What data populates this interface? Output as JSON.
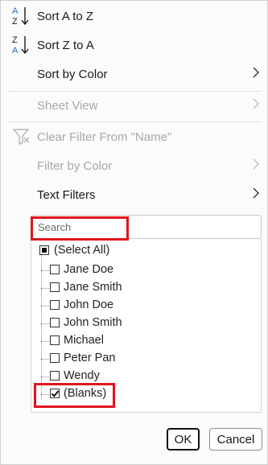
{
  "menu": {
    "sort_az": {
      "label": "Sort A to Z",
      "icon": "sort-ascending-icon",
      "icon_top": "A",
      "icon_bottom": "Z"
    },
    "sort_za": {
      "label": "Sort Z to A",
      "icon": "sort-descending-icon",
      "icon_top": "Z",
      "icon_bottom": "A"
    },
    "sort_color": {
      "label": "Sort by Color"
    },
    "sheet_view": {
      "label": "Sheet View"
    },
    "clear_filter": {
      "label": "Clear Filter From \"Name\"",
      "icon": "filter-clear-icon"
    },
    "filter_color": {
      "label": "Filter by Color"
    },
    "text_filters": {
      "label": "Text Filters"
    }
  },
  "search": {
    "placeholder": "Search"
  },
  "list": {
    "items": [
      {
        "label": "(Select All)",
        "state": "partial"
      },
      {
        "label": "Jane Doe",
        "state": "unchecked"
      },
      {
        "label": "Jane Smith",
        "state": "unchecked"
      },
      {
        "label": "John Doe",
        "state": "unchecked"
      },
      {
        "label": "John Smith",
        "state": "unchecked"
      },
      {
        "label": "Michael",
        "state": "unchecked"
      },
      {
        "label": "Peter Pan",
        "state": "unchecked"
      },
      {
        "label": "Wendy",
        "state": "unchecked"
      },
      {
        "label": "(Blanks)",
        "state": "checked"
      }
    ]
  },
  "buttons": {
    "ok": "OK",
    "cancel": "Cancel"
  },
  "colors": {
    "highlight": "#e0151d",
    "disabled_text": "#a7a7a7",
    "sort_icon_blue": "#1f6fc4"
  }
}
